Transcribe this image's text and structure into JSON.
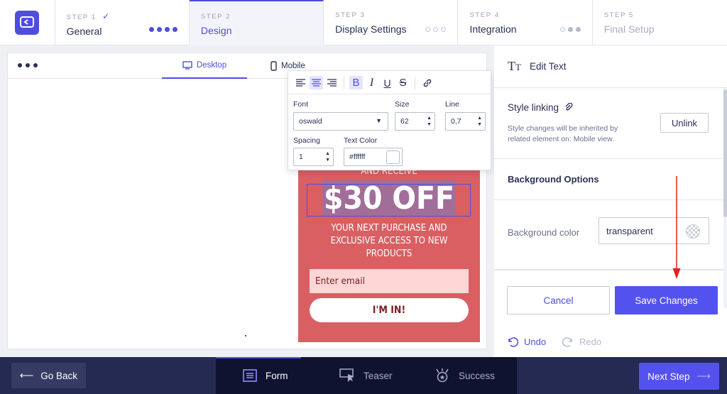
{
  "steps": [
    {
      "num": "STEP 1",
      "name": "General",
      "check": "✓"
    },
    {
      "num": "STEP 2",
      "name": "Design"
    },
    {
      "num": "STEP 3",
      "name": "Display Settings"
    },
    {
      "num": "STEP 4",
      "name": "Integration"
    },
    {
      "num": "STEP 5",
      "name": "Final Setup"
    }
  ],
  "canvas": {
    "tab_desktop": "Desktop",
    "tab_mobile": "Mobile"
  },
  "popup": {
    "receive": "AND RECEIVE",
    "headline": "$30 OFF",
    "subtitle": "YOUR NEXT PURCHASE AND EXCLUSIVE ACCESS TO NEW PRODUCTS",
    "email_placeholder": "Enter email",
    "cta": "I'M IN!",
    "bg_color": "#d95f63"
  },
  "text_toolbar": {
    "font_label": "Font",
    "font_value": "oswald",
    "size_label": "Size",
    "size_value": "62",
    "line_label": "Line",
    "line_value": "0,7",
    "spacing_label": "Spacing",
    "spacing_value": "1",
    "color_label": "Text Color",
    "color_value": "#ffffff"
  },
  "panel": {
    "title": "Edit Text",
    "style_linking_title": "Style linking",
    "style_linking_desc": "Style changes will be inherited by related element on: Mobile view.",
    "unlink_label": "Unlink",
    "bg_options_title": "Background Options",
    "bg_color_label": "Background color",
    "bg_color_value": "transparent",
    "cancel_label": "Cancel",
    "save_label": "Save Changes",
    "undo_label": "Undo",
    "redo_label": "Redo"
  },
  "bottom": {
    "go_back": "Go Back",
    "tab_form": "Form",
    "tab_teaser": "Teaser",
    "tab_success": "Success",
    "next_step": "Next Step"
  },
  "colors": {
    "accent": "#4f4ce0",
    "save_button": "#5452ee",
    "bottom_bar": "#242a52",
    "annotation_arrow": "#e8201c"
  }
}
